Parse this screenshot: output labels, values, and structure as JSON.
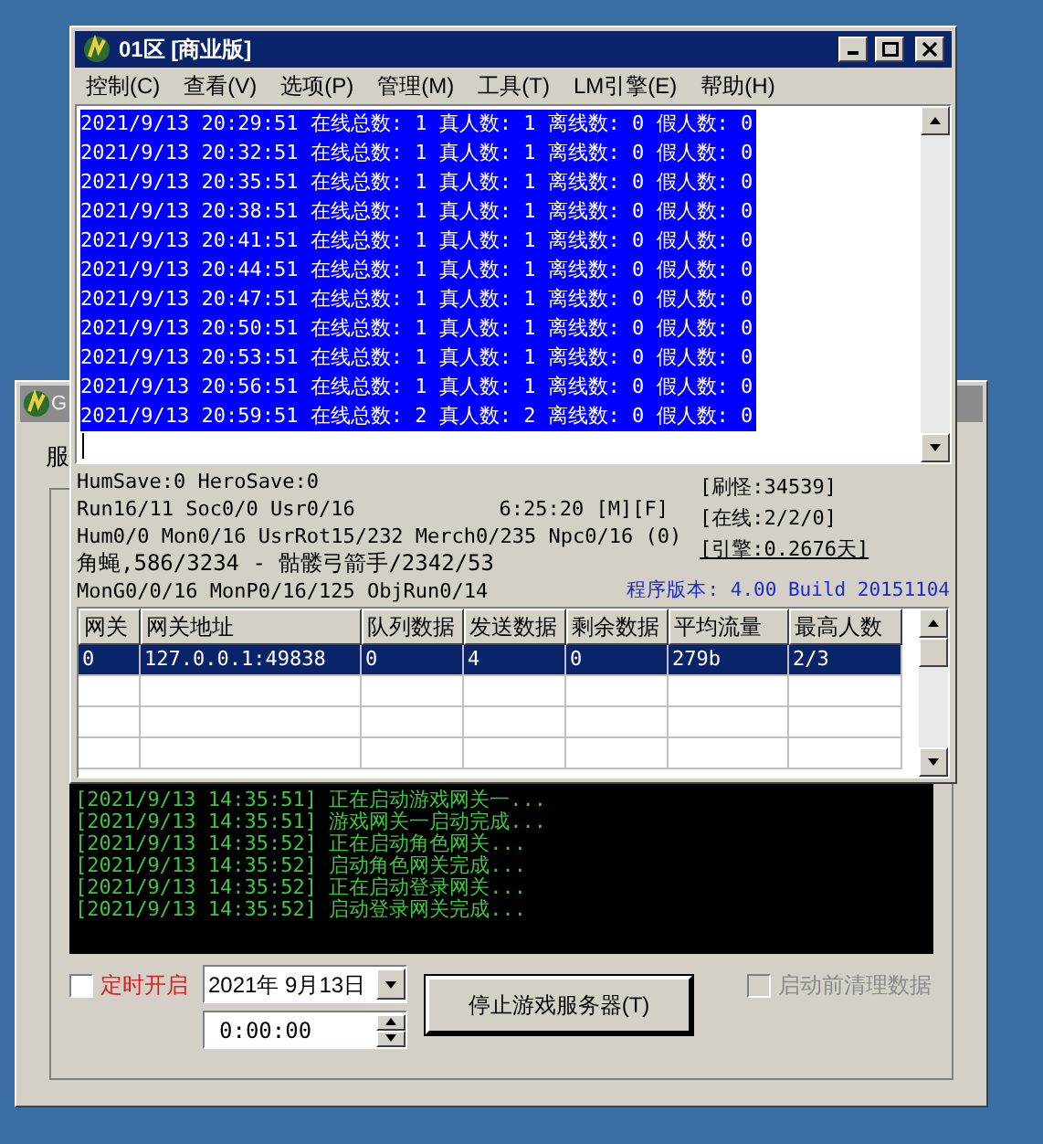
{
  "back_window": {
    "title": "G",
    "tab_label": "服",
    "log_lines": [
      "[2021/9/13 14:35:51] 正在启动游戏网关一...",
      "[2021/9/13 14:35:51] 游戏网关一启动完成...",
      "[2021/9/13 14:35:52] 正在启动角色网关...",
      "[2021/9/13 14:35:52] 启动角色网关完成...",
      "[2021/9/13 14:35:52] 正在启动登录网关...",
      "[2021/9/13 14:35:52] 启动登录网关完成..."
    ],
    "scheduled_start": {
      "label": "定时开启",
      "checked": false
    },
    "date": "2021年 9月13日",
    "time": "0:00:00",
    "stop_button": "停止游戏服务器(T)",
    "clear_data": {
      "label": "启动前清理数据",
      "checked": false,
      "disabled": true
    }
  },
  "front_window": {
    "title": "01区 [商业版]",
    "menu": [
      "控制(C)",
      "查看(V)",
      "选项(P)",
      "管理(M)",
      "工具(T)",
      "LM引擎(E)",
      "帮助(H)"
    ],
    "log_lines": [
      {
        "text": "2021/9/13 20:29:51 在线总数: 1 真人数: 1 离线数: 0 假人数: 0",
        "selected": true
      },
      {
        "text": "2021/9/13 20:32:51 在线总数: 1 真人数: 1 离线数: 0 假人数: 0",
        "selected": true
      },
      {
        "text": "2021/9/13 20:35:51 在线总数: 1 真人数: 1 离线数: 0 假人数: 0",
        "selected": true
      },
      {
        "text": "2021/9/13 20:38:51 在线总数: 1 真人数: 1 离线数: 0 假人数: 0",
        "selected": true
      },
      {
        "text": "2021/9/13 20:41:51 在线总数: 1 真人数: 1 离线数: 0 假人数: 0",
        "selected": true
      },
      {
        "text": "2021/9/13 20:44:51 在线总数: 1 真人数: 1 离线数: 0 假人数: 0",
        "selected": true
      },
      {
        "text": "2021/9/13 20:47:51 在线总数: 1 真人数: 1 离线数: 0 假人数: 0",
        "selected": true
      },
      {
        "text": "2021/9/13 20:50:51 在线总数: 1 真人数: 1 离线数: 0 假人数: 0",
        "selected": true
      },
      {
        "text": "2021/9/13 20:53:51 在线总数: 1 真人数: 1 离线数: 0 假人数: 0",
        "selected": true
      },
      {
        "text": "2021/9/13 20:56:51 在线总数: 1 真人数: 1 离线数: 0 假人数: 0",
        "selected": true
      },
      {
        "text": "2021/9/13 20:59:51 在线总数: 2 真人数: 2 离线数: 0 假人数: 0",
        "selected": true
      }
    ],
    "status": {
      "save": "HumSave:0 HeroSave:0",
      "run": "Run16/11 Soc0/0 Usr0/16",
      "clock": "6:25:20 [M][F]",
      "hum": "Hum0/0 Mon0/16 UsrRot15/232 Merch0/235 Npc0/16 (0)",
      "monster": "角蝇,586/3234 - 骷髅弓箭手/2342/53",
      "mon": "MonG0/0/16 MonP0/16/125 ObjRun0/14",
      "spawn": "[刷怪:34539]",
      "online": "[在线:2/2/0]",
      "engine": "[引擎:0.2676天]",
      "version": "程序版本: 4.00 Build 20151104"
    },
    "table": {
      "columns": [
        "网关",
        "网关地址",
        "队列数据",
        "发送数据",
        "剩余数据",
        "平均流量",
        "最高人数"
      ],
      "rows": [
        {
          "cells": [
            "0",
            "127.0.0.1:49838",
            "0",
            "4",
            "0",
            "279b",
            "2/3"
          ],
          "selected": true
        }
      ]
    }
  }
}
